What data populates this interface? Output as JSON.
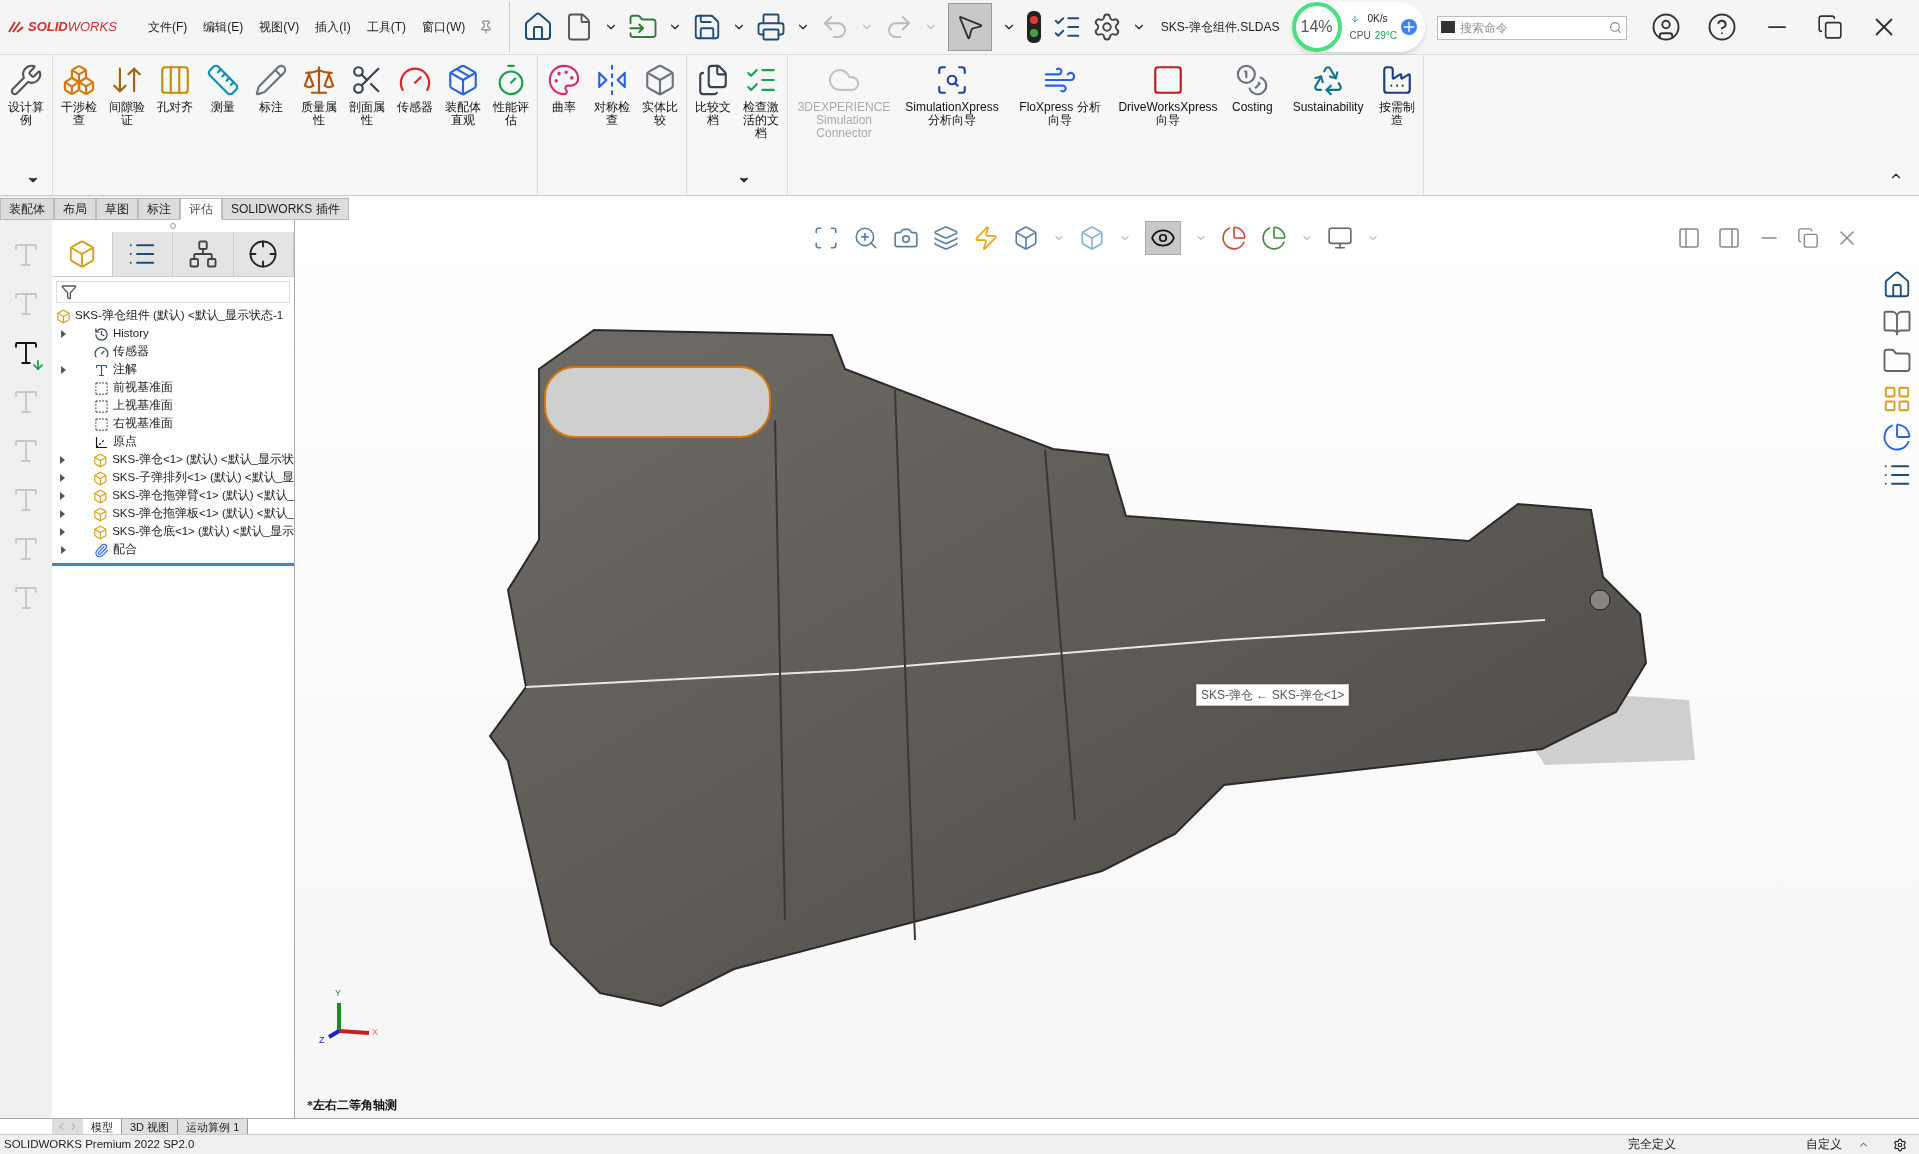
{
  "brand": "**SOLID**WORKS",
  "menus": [
    "文件(F)",
    "编辑(E)",
    "视图(V)",
    "插入(I)",
    "工具(T)",
    "窗口(W)"
  ],
  "document_title": "SKS-弹仓组件.SLDAS",
  "cpu_widget": {
    "usage": "14%",
    "speed": "0K/s",
    "label": "CPU",
    "temperature": "29°C"
  },
  "search": {
    "placeholder": "搜索命令"
  },
  "ribbon_groups": [
    {
      "items": [
        {
          "label": "设计算例",
          "disabled": false
        }
      ],
      "more": true
    },
    {
      "items": [
        {
          "label": "干涉检查",
          "disabled": false
        },
        {
          "label": "间隙验证",
          "disabled": false
        },
        {
          "label": "孔对齐",
          "disabled": false
        },
        {
          "label": "测量",
          "disabled": false
        },
        {
          "label": "标注",
          "disabled": false
        },
        {
          "label": "质量属性",
          "disabled": false
        },
        {
          "label": "剖面属性",
          "disabled": false
        },
        {
          "label": "传感器",
          "disabled": false
        },
        {
          "label": "装配体直观",
          "disabled": false
        },
        {
          "label": "性能评估",
          "disabled": false
        }
      ],
      "more": false
    },
    {
      "items": [
        {
          "label": "曲率",
          "disabled": false
        },
        {
          "label": "对称检查",
          "disabled": false
        },
        {
          "label": "实体比较",
          "disabled": false
        }
      ],
      "more": false
    },
    {
      "items": [
        {
          "label": "比较文档",
          "disabled": false
        },
        {
          "label": "检查激活的文档",
          "disabled": false
        }
      ],
      "more": true
    },
    {
      "items": [
        {
          "label": "3DEXPERIENCE Simulation Connector",
          "disabled": true
        },
        {
          "label": "SimulationXpress 分析向导",
          "disabled": false
        },
        {
          "label": "FloXpress 分析向导",
          "disabled": false
        },
        {
          "label": "DriveWorksXpress 向导",
          "disabled": false
        },
        {
          "label": "Costing",
          "disabled": false
        },
        {
          "label": "Sustainability",
          "disabled": false
        },
        {
          "label": "按需制造",
          "disabled": false
        }
      ],
      "more": false
    }
  ],
  "command_tabs": [
    {
      "label": "装配体",
      "selected": false
    },
    {
      "label": "布局",
      "selected": false
    },
    {
      "label": "草图",
      "selected": false
    },
    {
      "label": "标注",
      "selected": false
    },
    {
      "label": "评估",
      "selected": true
    },
    {
      "label": "SOLIDWORKS 插件",
      "selected": false
    }
  ],
  "left_tools": [
    {
      "enabled": false
    },
    {
      "enabled": false
    },
    {
      "enabled": true
    },
    {
      "enabled": false
    },
    {
      "enabled": false
    },
    {
      "enabled": false
    },
    {
      "enabled": false
    },
    {
      "enabled": false
    }
  ],
  "panel_tabs": [
    {
      "selected": true
    },
    {
      "selected": false
    },
    {
      "selected": false
    },
    {
      "selected": false
    }
  ],
  "tree": {
    "label": "SKS-弹仓组件 (默认) <默认_显示状态-1",
    "kind": "assembly",
    "children": [
      {
        "label": "History",
        "kind": "history",
        "expandable": true
      },
      {
        "label": "传感器",
        "kind": "sensor",
        "expandable": false
      },
      {
        "label": "注解",
        "kind": "annotation",
        "expandable": true
      },
      {
        "label": "前视基准面",
        "kind": "plane",
        "expandable": false
      },
      {
        "label": "上视基准面",
        "kind": "plane",
        "expandable": false
      },
      {
        "label": "右视基准面",
        "kind": "plane",
        "expandable": false
      },
      {
        "label": "原点",
        "kind": "origin",
        "expandable": false
      },
      {
        "label": "SKS-弹仓<1> (默认) <默认_显示状",
        "kind": "part",
        "expandable": true
      },
      {
        "label": "SKS-子弹排列<1> (默认) <默认_显",
        "kind": "part",
        "expandable": true
      },
      {
        "label": "SKS-弹仓拖弹臂<1> (默认) <默认_",
        "kind": "part",
        "expandable": true
      },
      {
        "label": "SKS-弹仓拖弹板<1> (默认) <默认_",
        "kind": "part",
        "expandable": true
      },
      {
        "label": "SKS-弹仓底<1> (默认) <默认_显示",
        "kind": "part",
        "expandable": true
      },
      {
        "label": "配合",
        "kind": "mates",
        "expandable": true
      }
    ]
  },
  "viewport": {
    "tooltip": "SKS-弹仓 ← SKS-弹仓<1>",
    "axes": {
      "y": "Y",
      "x": "X",
      "z": "Z"
    },
    "view_name": "*左右二等角轴测"
  },
  "bottom_tabs": [
    {
      "label": "模型",
      "selected": true
    },
    {
      "label": "3D 视图",
      "selected": false
    },
    {
      "label": "运动算例 1",
      "selected": false
    }
  ],
  "status_bar": {
    "product": "SOLIDWORKS Premium 2022 SP2.0",
    "status": "完全定义",
    "units": "自定义"
  }
}
